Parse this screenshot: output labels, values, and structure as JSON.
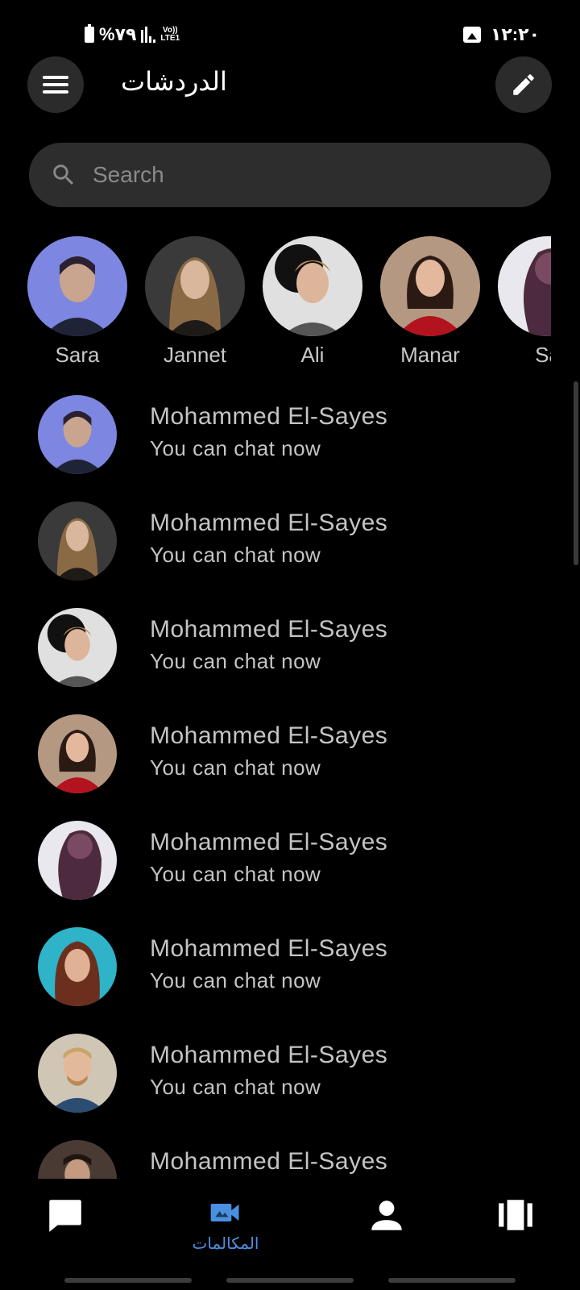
{
  "status_bar": {
    "battery_text": "%٧٩",
    "network_label": "Vo)) LTE1",
    "time": "١٢:٢٠"
  },
  "header": {
    "title": "الدردشات",
    "menu_icon": "hamburger-menu-icon",
    "compose_icon": "pencil-icon"
  },
  "search": {
    "placeholder": "Search",
    "icon": "search-icon"
  },
  "stories": [
    {
      "name": "Sara"
    },
    {
      "name": "Jannet"
    },
    {
      "name": "Ali"
    },
    {
      "name": "Manar"
    },
    {
      "name": "Sa"
    }
  ],
  "chats": [
    {
      "name": "Mohammed El-Sayes",
      "message": "You can chat now"
    },
    {
      "name": "Mohammed El-Sayes",
      "message": "You can chat now"
    },
    {
      "name": "Mohammed El-Sayes",
      "message": "You can chat now"
    },
    {
      "name": "Mohammed El-Sayes",
      "message": "You can chat now"
    },
    {
      "name": "Mohammed El-Sayes",
      "message": "You can chat now"
    },
    {
      "name": "Mohammed El-Sayes",
      "message": "You can chat now"
    },
    {
      "name": "Mohammed El-Sayes",
      "message": "You can chat now"
    },
    {
      "name": "Mohammed El-Sayes",
      "message": ""
    }
  ],
  "bottom_nav": {
    "items": [
      {
        "icon": "chat-bubble-icon",
        "label": ""
      },
      {
        "icon": "video-camera-icon",
        "label": "المكالمات"
      },
      {
        "icon": "person-icon",
        "label": ""
      },
      {
        "icon": "stories-carousel-icon",
        "label": ""
      }
    ],
    "active_color": "#4a90e2"
  },
  "colors": {
    "background": "#000000",
    "surface": "#2b2b2b",
    "accent": "#4a90e2"
  }
}
